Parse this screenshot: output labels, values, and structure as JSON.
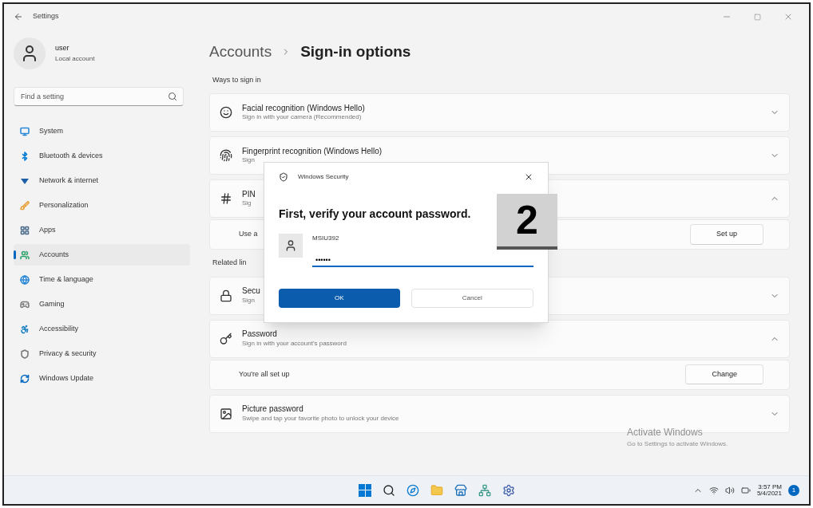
{
  "window": {
    "title": "Settings"
  },
  "account": {
    "name": "user",
    "type": "Local account"
  },
  "search": {
    "placeholder": "Find a setting"
  },
  "nav": [
    {
      "label": "System",
      "selected": false,
      "color": "#2b88d8"
    },
    {
      "label": "Bluetooth & devices",
      "selected": false,
      "color": "#0078d4"
    },
    {
      "label": "Network & internet",
      "selected": false,
      "color": "#1f5fa8"
    },
    {
      "label": "Personalization",
      "selected": false,
      "color": "#e8a33d"
    },
    {
      "label": "Apps",
      "selected": false,
      "color": "#4a6d8c"
    },
    {
      "label": "Accounts",
      "selected": true,
      "color": "#2ea36b"
    },
    {
      "label": "Time & language",
      "selected": false,
      "color": "#2b88d8"
    },
    {
      "label": "Gaming",
      "selected": false,
      "color": "#7a7a7a"
    },
    {
      "label": "Accessibility",
      "selected": false,
      "color": "#1a7fc4"
    },
    {
      "label": "Privacy & security",
      "selected": false,
      "color": "#7a7a7a"
    },
    {
      "label": "Windows Update",
      "selected": false,
      "color": "#0067c0"
    }
  ],
  "breadcrumb": {
    "parent": "Accounts",
    "current": "Sign-in options"
  },
  "items": [
    {
      "kind": "label",
      "text": "Ways to sign in"
    },
    {
      "kind": "row",
      "title": "Facial recognition (Windows Hello)",
      "subtitle": "Sign in with your camera (Recommended)",
      "expanded": false
    },
    {
      "kind": "row",
      "title": "Fingerprint recognition (Windows Hello)",
      "subtitle": "Sign",
      "expanded": false
    },
    {
      "kind": "row",
      "title": "PIN",
      "subtitle": "Sig",
      "expanded": true,
      "detail": {
        "text": "Use a",
        "button": "Set up"
      }
    },
    {
      "kind": "label",
      "text": "Related lin"
    },
    {
      "kind": "row",
      "title": "Secu",
      "subtitle": "Sign",
      "expanded": false
    },
    {
      "kind": "row",
      "title": "Password",
      "subtitle": "Sign in with your account's password",
      "expanded": true,
      "detail": {
        "text": "You're all set up",
        "button": "Change"
      }
    },
    {
      "kind": "row",
      "title": "Picture password",
      "subtitle": "Swipe and tap your favorite photo to unlock your device",
      "expanded": false
    }
  ],
  "activation_notice": {
    "title": "Activate Windows",
    "subtitle": "Go to Settings to activate Windows."
  },
  "dialog": {
    "title": "Windows Security",
    "heading": "First, verify your account password.",
    "username": "MSIU392",
    "password": "••••••",
    "buttons": [
      {
        "label": "OK",
        "primary": true
      },
      {
        "label": "Cancel",
        "primary": false
      }
    ]
  },
  "step_badge": "2",
  "taskbar": {
    "time": "3:57 PM",
    "date": "5/4/2021",
    "notifications": "1"
  }
}
